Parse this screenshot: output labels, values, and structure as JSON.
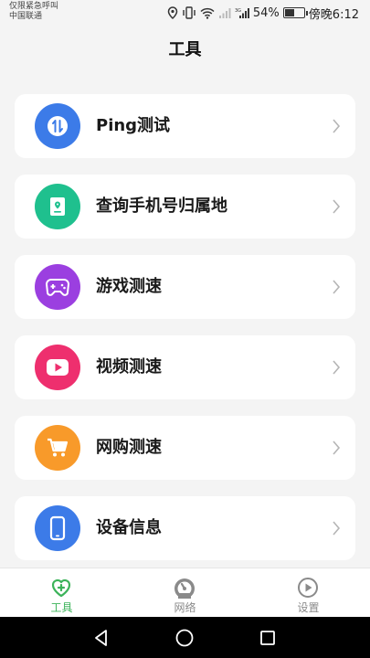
{
  "status_bar": {
    "carrier_line1": "仅限紧急呼叫",
    "carrier_line2": "中国联通",
    "battery": "54%",
    "battery_level": 0.54,
    "time": "傍晚6:12"
  },
  "header": {
    "title": "工具"
  },
  "tools": [
    {
      "label": "Ping测试",
      "icon": "ping-icon",
      "color": "#3c7be8"
    },
    {
      "label": "查询手机号归属地",
      "icon": "phone-location-icon",
      "color": "#1fc08e"
    },
    {
      "label": "游戏测速",
      "icon": "gamepad-icon",
      "color": "#9b3fe0"
    },
    {
      "label": "视频测速",
      "icon": "video-play-icon",
      "color": "#ee2f6e"
    },
    {
      "label": "网购测速",
      "icon": "shopping-cart-icon",
      "color": "#f89a2a"
    },
    {
      "label": "设备信息",
      "icon": "smartphone-icon",
      "color": "#3c7be8"
    }
  ],
  "bottom_nav": {
    "active_color": "#3cb35a",
    "inactive_color": "#8a8a8a",
    "items": [
      {
        "label": "工具",
        "icon": "heart-plus-icon",
        "active": true
      },
      {
        "label": "网络",
        "icon": "speedometer-icon",
        "active": false
      },
      {
        "label": "设置",
        "icon": "play-circle-icon",
        "active": false
      }
    ]
  }
}
